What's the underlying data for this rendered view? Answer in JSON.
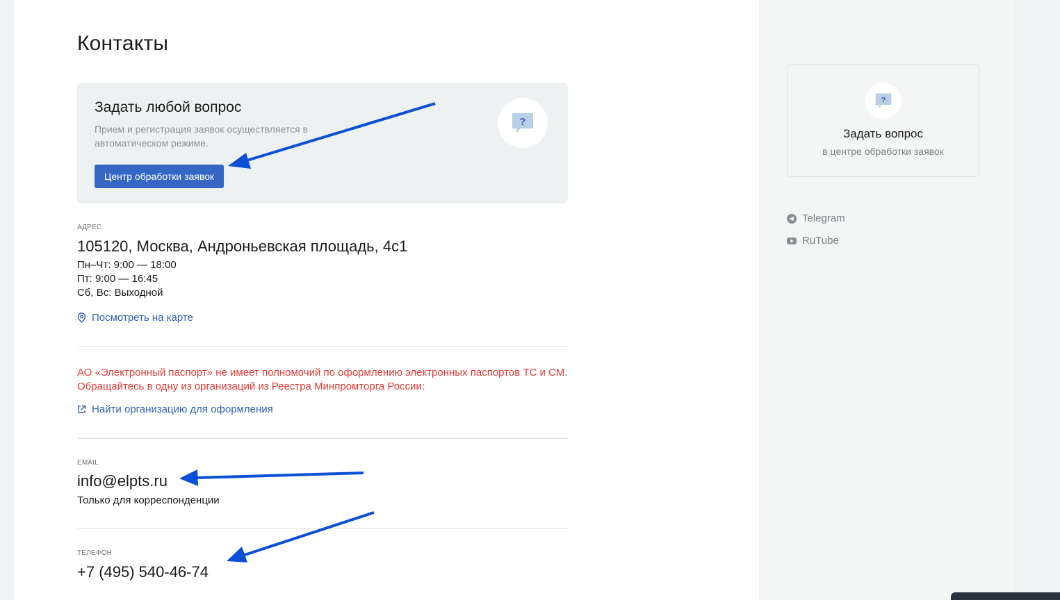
{
  "page": {
    "title": "Контакты"
  },
  "ask_card": {
    "title": "Задать любой вопрос",
    "description": "Прием и регистрация заявок осуществляется в автоматическом режиме.",
    "button_label": "Центр обработки заявок",
    "icon": "question-bubble-icon"
  },
  "address": {
    "label": "Адрес",
    "value": "105120, Москва, Андроньевская площадь, 4с1",
    "hours": [
      "Пн–Чт: 9:00 — 18:00",
      "Пт: 9:00 — 16:45",
      "Сб, Вс: Выходной"
    ],
    "map_link": "Посмотреть на карте",
    "map_icon": "location-pin-icon"
  },
  "notice": {
    "text": "АО «Электронный паспорт» не имеет полномочий по оформлению электронных паспортов ТС и СМ. Обращайтесь в одну из организаций из Реестра Минпромторга России:",
    "link": "Найти организацию для оформления",
    "link_icon": "external-link-icon",
    "color": "#e53935"
  },
  "email": {
    "label": "Email",
    "value": "info@elpts.ru",
    "note": "Только для корреспонденции"
  },
  "phone": {
    "label": "Телефон",
    "value": "+7 (495) 540-46-74"
  },
  "sidebar": {
    "card_title": "Задать вопрос",
    "card_subtitle": "в центре обработки заявок",
    "card_icon": "question-bubble-icon",
    "social": [
      {
        "label": "Telegram",
        "icon": "telegram-icon"
      },
      {
        "label": "RuTube",
        "icon": "rutube-icon"
      }
    ]
  },
  "colors": {
    "accent": "#3566c4",
    "link": "#2f5fb3",
    "annotation_arrow": "#0a4fd6"
  }
}
